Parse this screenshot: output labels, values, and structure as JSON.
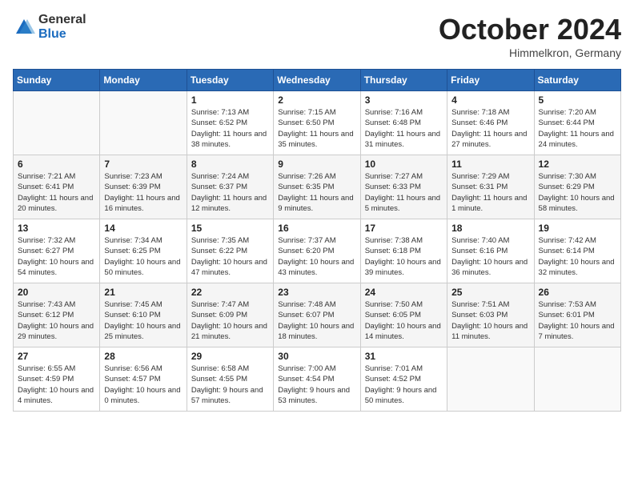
{
  "header": {
    "logo_general": "General",
    "logo_blue": "Blue",
    "month_title": "October 2024",
    "subtitle": "Himmelkron, Germany"
  },
  "weekdays": [
    "Sunday",
    "Monday",
    "Tuesday",
    "Wednesday",
    "Thursday",
    "Friday",
    "Saturday"
  ],
  "weeks": [
    [
      {
        "day": "",
        "info": ""
      },
      {
        "day": "",
        "info": ""
      },
      {
        "day": "1",
        "info": "Sunrise: 7:13 AM\nSunset: 6:52 PM\nDaylight: 11 hours\nand 38 minutes."
      },
      {
        "day": "2",
        "info": "Sunrise: 7:15 AM\nSunset: 6:50 PM\nDaylight: 11 hours\nand 35 minutes."
      },
      {
        "day": "3",
        "info": "Sunrise: 7:16 AM\nSunset: 6:48 PM\nDaylight: 11 hours\nand 31 minutes."
      },
      {
        "day": "4",
        "info": "Sunrise: 7:18 AM\nSunset: 6:46 PM\nDaylight: 11 hours\nand 27 minutes."
      },
      {
        "day": "5",
        "info": "Sunrise: 7:20 AM\nSunset: 6:44 PM\nDaylight: 11 hours\nand 24 minutes."
      }
    ],
    [
      {
        "day": "6",
        "info": "Sunrise: 7:21 AM\nSunset: 6:41 PM\nDaylight: 11 hours\nand 20 minutes."
      },
      {
        "day": "7",
        "info": "Sunrise: 7:23 AM\nSunset: 6:39 PM\nDaylight: 11 hours\nand 16 minutes."
      },
      {
        "day": "8",
        "info": "Sunrise: 7:24 AM\nSunset: 6:37 PM\nDaylight: 11 hours\nand 12 minutes."
      },
      {
        "day": "9",
        "info": "Sunrise: 7:26 AM\nSunset: 6:35 PM\nDaylight: 11 hours\nand 9 minutes."
      },
      {
        "day": "10",
        "info": "Sunrise: 7:27 AM\nSunset: 6:33 PM\nDaylight: 11 hours\nand 5 minutes."
      },
      {
        "day": "11",
        "info": "Sunrise: 7:29 AM\nSunset: 6:31 PM\nDaylight: 11 hours\nand 1 minute."
      },
      {
        "day": "12",
        "info": "Sunrise: 7:30 AM\nSunset: 6:29 PM\nDaylight: 10 hours\nand 58 minutes."
      }
    ],
    [
      {
        "day": "13",
        "info": "Sunrise: 7:32 AM\nSunset: 6:27 PM\nDaylight: 10 hours\nand 54 minutes."
      },
      {
        "day": "14",
        "info": "Sunrise: 7:34 AM\nSunset: 6:25 PM\nDaylight: 10 hours\nand 50 minutes."
      },
      {
        "day": "15",
        "info": "Sunrise: 7:35 AM\nSunset: 6:22 PM\nDaylight: 10 hours\nand 47 minutes."
      },
      {
        "day": "16",
        "info": "Sunrise: 7:37 AM\nSunset: 6:20 PM\nDaylight: 10 hours\nand 43 minutes."
      },
      {
        "day": "17",
        "info": "Sunrise: 7:38 AM\nSunset: 6:18 PM\nDaylight: 10 hours\nand 39 minutes."
      },
      {
        "day": "18",
        "info": "Sunrise: 7:40 AM\nSunset: 6:16 PM\nDaylight: 10 hours\nand 36 minutes."
      },
      {
        "day": "19",
        "info": "Sunrise: 7:42 AM\nSunset: 6:14 PM\nDaylight: 10 hours\nand 32 minutes."
      }
    ],
    [
      {
        "day": "20",
        "info": "Sunrise: 7:43 AM\nSunset: 6:12 PM\nDaylight: 10 hours\nand 29 minutes."
      },
      {
        "day": "21",
        "info": "Sunrise: 7:45 AM\nSunset: 6:10 PM\nDaylight: 10 hours\nand 25 minutes."
      },
      {
        "day": "22",
        "info": "Sunrise: 7:47 AM\nSunset: 6:09 PM\nDaylight: 10 hours\nand 21 minutes."
      },
      {
        "day": "23",
        "info": "Sunrise: 7:48 AM\nSunset: 6:07 PM\nDaylight: 10 hours\nand 18 minutes."
      },
      {
        "day": "24",
        "info": "Sunrise: 7:50 AM\nSunset: 6:05 PM\nDaylight: 10 hours\nand 14 minutes."
      },
      {
        "day": "25",
        "info": "Sunrise: 7:51 AM\nSunset: 6:03 PM\nDaylight: 10 hours\nand 11 minutes."
      },
      {
        "day": "26",
        "info": "Sunrise: 7:53 AM\nSunset: 6:01 PM\nDaylight: 10 hours\nand 7 minutes."
      }
    ],
    [
      {
        "day": "27",
        "info": "Sunrise: 6:55 AM\nSunset: 4:59 PM\nDaylight: 10 hours\nand 4 minutes."
      },
      {
        "day": "28",
        "info": "Sunrise: 6:56 AM\nSunset: 4:57 PM\nDaylight: 10 hours\nand 0 minutes."
      },
      {
        "day": "29",
        "info": "Sunrise: 6:58 AM\nSunset: 4:55 PM\nDaylight: 9 hours\nand 57 minutes."
      },
      {
        "day": "30",
        "info": "Sunrise: 7:00 AM\nSunset: 4:54 PM\nDaylight: 9 hours\nand 53 minutes."
      },
      {
        "day": "31",
        "info": "Sunrise: 7:01 AM\nSunset: 4:52 PM\nDaylight: 9 hours\nand 50 minutes."
      },
      {
        "day": "",
        "info": ""
      },
      {
        "day": "",
        "info": ""
      }
    ]
  ]
}
